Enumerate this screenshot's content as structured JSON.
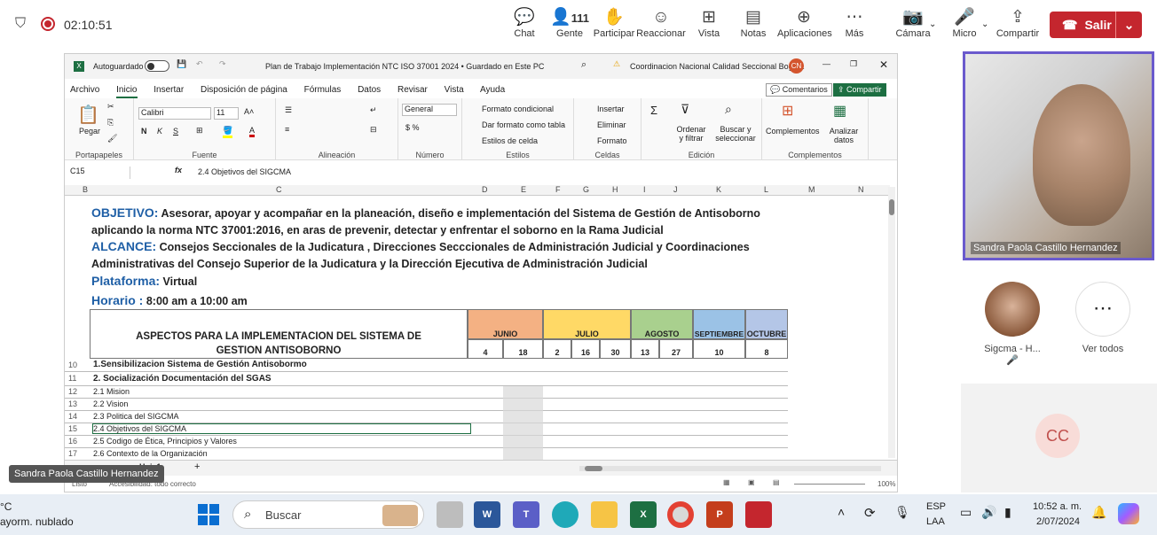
{
  "meeting": {
    "timer": "02:10:51",
    "participants_count": "111",
    "buttons": [
      "Chat",
      "Gente",
      "Participar",
      "Reaccionar",
      "Vista",
      "Notas",
      "Aplicaciones",
      "Más"
    ],
    "right_buttons": [
      "Cámara",
      "Micro",
      "Compartir"
    ],
    "leave_label": "Salir",
    "main_video_name": "Sandra Paola Castillo Hernandez",
    "tile1_name": "Sigcma - H...",
    "tile2_name": "Ver todos",
    "cc_initials": "CC",
    "presenter_label": "Sandra Paola Castillo Hernandez"
  },
  "excel": {
    "autosave_label": "Autoguardado",
    "title": "Plan de Trabajo Implementación NTC ISO 37001 2024 • Guardado en Este PC",
    "account": "Coordinacion Nacional Calidad Seccional Bogotá",
    "account_initials": "CN",
    "tabs": [
      "Archivo",
      "Inicio",
      "Insertar",
      "Disposición de página",
      "Fórmulas",
      "Datos",
      "Revisar",
      "Vista",
      "Ayuda"
    ],
    "comments_label": "Comentarios",
    "share_label": "Compartir",
    "font_name": "Calibri",
    "font_size": "11",
    "number_format": "General",
    "groups": [
      "Portapapeles",
      "Fuente",
      "Alineación",
      "Número",
      "Estilos",
      "Celdas",
      "Edición",
      "Complementos"
    ],
    "styles_items": [
      "Formato condicional",
      "Dar formato como tabla",
      "Estilos de celda"
    ],
    "cells_items": [
      "Insertar",
      "Eliminar",
      "Formato"
    ],
    "paste_label": "Pegar",
    "sort_label": "Ordenar y filtrar",
    "find_label": "Buscar y seleccionar",
    "addins_label": "Complementos",
    "analyze_label": "Analizar datos",
    "name_box": "C15",
    "formula": "2.4 Objetivos del SIGCMA",
    "col_headers": [
      "B",
      "C",
      "D",
      "E",
      "F",
      "G",
      "H",
      "I",
      "J",
      "K",
      "L",
      "M",
      "N"
    ],
    "objetivo_label": "OBJETIVO:",
    "objetivo_text": "Asesorar, apoyar y acompañar en la planeación, diseño e implementación  del Sistema de Gestión de Antisoborno aplicando la norma NTC 37001:2016, en aras de prevenir, detectar y enfrentar el soborno en la Rama Judicial",
    "alcance_label": "ALCANCE:",
    "alcance_text": "Consejos Seccionales de la Judicatura , Direcciones Secccionales de Administración Judicial y Coordinaciones Administrativas del Consejo Superior de la Judicatura y la Dirección Ejecutiva de Administración Judicial",
    "plataforma_label": "Plataforma:",
    "plataforma_value": "Virtual",
    "horario_label": "Horario :",
    "horario_value": "8:00 am a 10:00 am",
    "table_header": "ASPECTOS PARA LA IMPLEMENTACION DEL SISTEMA DE GESTION ANTISOBORNO",
    "months": [
      "JUNIO",
      "JULIO",
      "AGOSTO",
      "SEPTIEMBRE",
      "OCTUBRE"
    ],
    "days": [
      "4",
      "18",
      "2",
      "16",
      "30",
      "13",
      "27",
      "10",
      "8"
    ],
    "rows": [
      {
        "n": "10",
        "text": "1.Sensibilizacion Sistema de Gestión Antisobormo",
        "bold": true
      },
      {
        "n": "11",
        "text": "2. Socialización Documentación del SGAS",
        "bold": true
      },
      {
        "n": "12",
        "text": "2.1 Mision",
        "bold": false
      },
      {
        "n": "13",
        "text": "2.2 Vision",
        "bold": false
      },
      {
        "n": "14",
        "text": "2.3 Politica del SIGCMA",
        "bold": false
      },
      {
        "n": "15",
        "text": "2.4 Objetivos del SIGCMA",
        "bold": false
      },
      {
        "n": "16",
        "text": "2.5 Codigo de Ética, Principios y Valores",
        "bold": false
      },
      {
        "n": "17",
        "text": "2.6 Contexto de la Organización",
        "bold": false
      }
    ],
    "sheet_tab": "Hoja1",
    "status_left": "Listo",
    "status_access": "Accesibilidad: todo correcto",
    "zoom": "100%"
  },
  "taskbar": {
    "weather_temp": "°C",
    "weather_text": "ayorm. nublado",
    "search_placeholder": "Buscar",
    "lang1": "ESP",
    "lang2": "LAA",
    "time": "10:52 a. m.",
    "date": "2/07/2024"
  }
}
